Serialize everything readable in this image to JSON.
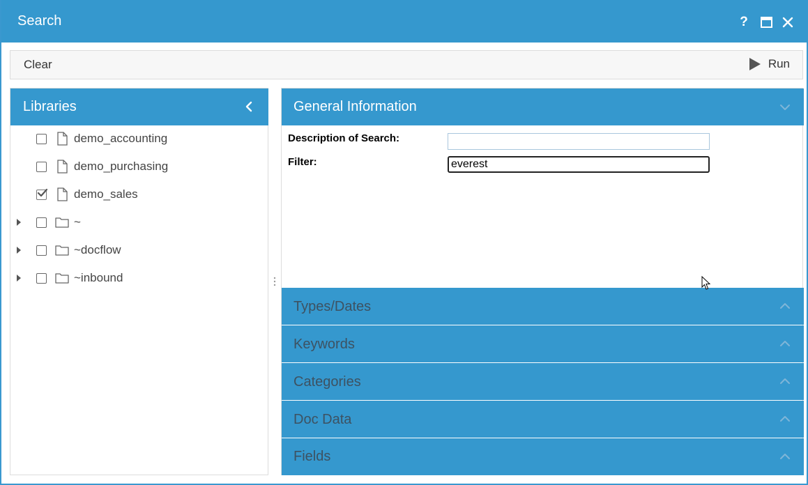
{
  "window": {
    "title": "Search",
    "help_label": "?",
    "icons": [
      "maximize-icon",
      "close-icon"
    ]
  },
  "toolbar": {
    "clear_label": "Clear",
    "run_label": "Run"
  },
  "libraries": {
    "title": "Libraries",
    "items": [
      {
        "label": "demo_accounting",
        "type": "file",
        "checked": false,
        "expandable": false
      },
      {
        "label": "demo_purchasing",
        "type": "file",
        "checked": false,
        "expandable": false
      },
      {
        "label": "demo_sales",
        "type": "file",
        "checked": true,
        "expandable": false
      },
      {
        "label": "~",
        "type": "folder",
        "checked": false,
        "expandable": true
      },
      {
        "label": "~docflow",
        "type": "folder",
        "checked": false,
        "expandable": true
      },
      {
        "label": "~inbound",
        "type": "folder",
        "checked": false,
        "expandable": true
      }
    ]
  },
  "general": {
    "title": "General Information",
    "description_label": "Description of Search:",
    "description_value": "",
    "filter_label": "Filter:",
    "filter_value": "everest"
  },
  "sections": [
    {
      "title": "Types/Dates"
    },
    {
      "title": "Keywords"
    },
    {
      "title": "Categories"
    },
    {
      "title": "Doc Data"
    },
    {
      "title": "Fields"
    }
  ],
  "colors": {
    "accent": "#3598ce",
    "collapsed_title": "#3d5262",
    "expanded_title": "#ffffff"
  }
}
